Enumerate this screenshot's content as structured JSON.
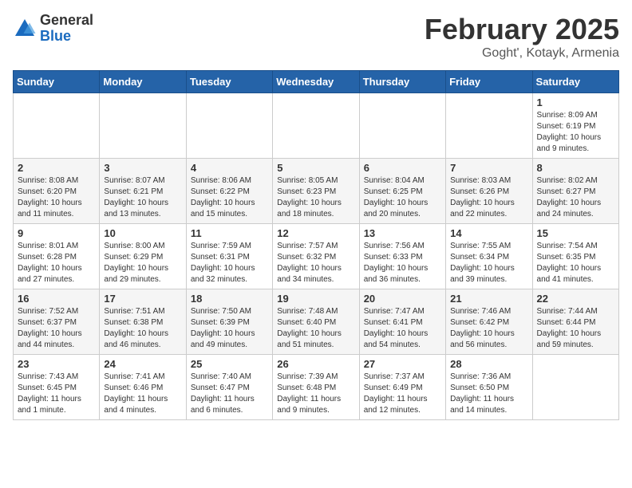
{
  "header": {
    "logo_general": "General",
    "logo_blue": "Blue",
    "title": "February 2025",
    "subtitle": "Goght', Kotayk, Armenia"
  },
  "days_of_week": [
    "Sunday",
    "Monday",
    "Tuesday",
    "Wednesday",
    "Thursday",
    "Friday",
    "Saturday"
  ],
  "weeks": [
    [
      {
        "day": "",
        "info": ""
      },
      {
        "day": "",
        "info": ""
      },
      {
        "day": "",
        "info": ""
      },
      {
        "day": "",
        "info": ""
      },
      {
        "day": "",
        "info": ""
      },
      {
        "day": "",
        "info": ""
      },
      {
        "day": "1",
        "info": "Sunrise: 8:09 AM\nSunset: 6:19 PM\nDaylight: 10 hours and 9 minutes."
      }
    ],
    [
      {
        "day": "2",
        "info": "Sunrise: 8:08 AM\nSunset: 6:20 PM\nDaylight: 10 hours and 11 minutes."
      },
      {
        "day": "3",
        "info": "Sunrise: 8:07 AM\nSunset: 6:21 PM\nDaylight: 10 hours and 13 minutes."
      },
      {
        "day": "4",
        "info": "Sunrise: 8:06 AM\nSunset: 6:22 PM\nDaylight: 10 hours and 15 minutes."
      },
      {
        "day": "5",
        "info": "Sunrise: 8:05 AM\nSunset: 6:23 PM\nDaylight: 10 hours and 18 minutes."
      },
      {
        "day": "6",
        "info": "Sunrise: 8:04 AM\nSunset: 6:25 PM\nDaylight: 10 hours and 20 minutes."
      },
      {
        "day": "7",
        "info": "Sunrise: 8:03 AM\nSunset: 6:26 PM\nDaylight: 10 hours and 22 minutes."
      },
      {
        "day": "8",
        "info": "Sunrise: 8:02 AM\nSunset: 6:27 PM\nDaylight: 10 hours and 24 minutes."
      }
    ],
    [
      {
        "day": "9",
        "info": "Sunrise: 8:01 AM\nSunset: 6:28 PM\nDaylight: 10 hours and 27 minutes."
      },
      {
        "day": "10",
        "info": "Sunrise: 8:00 AM\nSunset: 6:29 PM\nDaylight: 10 hours and 29 minutes."
      },
      {
        "day": "11",
        "info": "Sunrise: 7:59 AM\nSunset: 6:31 PM\nDaylight: 10 hours and 32 minutes."
      },
      {
        "day": "12",
        "info": "Sunrise: 7:57 AM\nSunset: 6:32 PM\nDaylight: 10 hours and 34 minutes."
      },
      {
        "day": "13",
        "info": "Sunrise: 7:56 AM\nSunset: 6:33 PM\nDaylight: 10 hours and 36 minutes."
      },
      {
        "day": "14",
        "info": "Sunrise: 7:55 AM\nSunset: 6:34 PM\nDaylight: 10 hours and 39 minutes."
      },
      {
        "day": "15",
        "info": "Sunrise: 7:54 AM\nSunset: 6:35 PM\nDaylight: 10 hours and 41 minutes."
      }
    ],
    [
      {
        "day": "16",
        "info": "Sunrise: 7:52 AM\nSunset: 6:37 PM\nDaylight: 10 hours and 44 minutes."
      },
      {
        "day": "17",
        "info": "Sunrise: 7:51 AM\nSunset: 6:38 PM\nDaylight: 10 hours and 46 minutes."
      },
      {
        "day": "18",
        "info": "Sunrise: 7:50 AM\nSunset: 6:39 PM\nDaylight: 10 hours and 49 minutes."
      },
      {
        "day": "19",
        "info": "Sunrise: 7:48 AM\nSunset: 6:40 PM\nDaylight: 10 hours and 51 minutes."
      },
      {
        "day": "20",
        "info": "Sunrise: 7:47 AM\nSunset: 6:41 PM\nDaylight: 10 hours and 54 minutes."
      },
      {
        "day": "21",
        "info": "Sunrise: 7:46 AM\nSunset: 6:42 PM\nDaylight: 10 hours and 56 minutes."
      },
      {
        "day": "22",
        "info": "Sunrise: 7:44 AM\nSunset: 6:44 PM\nDaylight: 10 hours and 59 minutes."
      }
    ],
    [
      {
        "day": "23",
        "info": "Sunrise: 7:43 AM\nSunset: 6:45 PM\nDaylight: 11 hours and 1 minute."
      },
      {
        "day": "24",
        "info": "Sunrise: 7:41 AM\nSunset: 6:46 PM\nDaylight: 11 hours and 4 minutes."
      },
      {
        "day": "25",
        "info": "Sunrise: 7:40 AM\nSunset: 6:47 PM\nDaylight: 11 hours and 6 minutes."
      },
      {
        "day": "26",
        "info": "Sunrise: 7:39 AM\nSunset: 6:48 PM\nDaylight: 11 hours and 9 minutes."
      },
      {
        "day": "27",
        "info": "Sunrise: 7:37 AM\nSunset: 6:49 PM\nDaylight: 11 hours and 12 minutes."
      },
      {
        "day": "28",
        "info": "Sunrise: 7:36 AM\nSunset: 6:50 PM\nDaylight: 11 hours and 14 minutes."
      },
      {
        "day": "",
        "info": ""
      }
    ]
  ]
}
